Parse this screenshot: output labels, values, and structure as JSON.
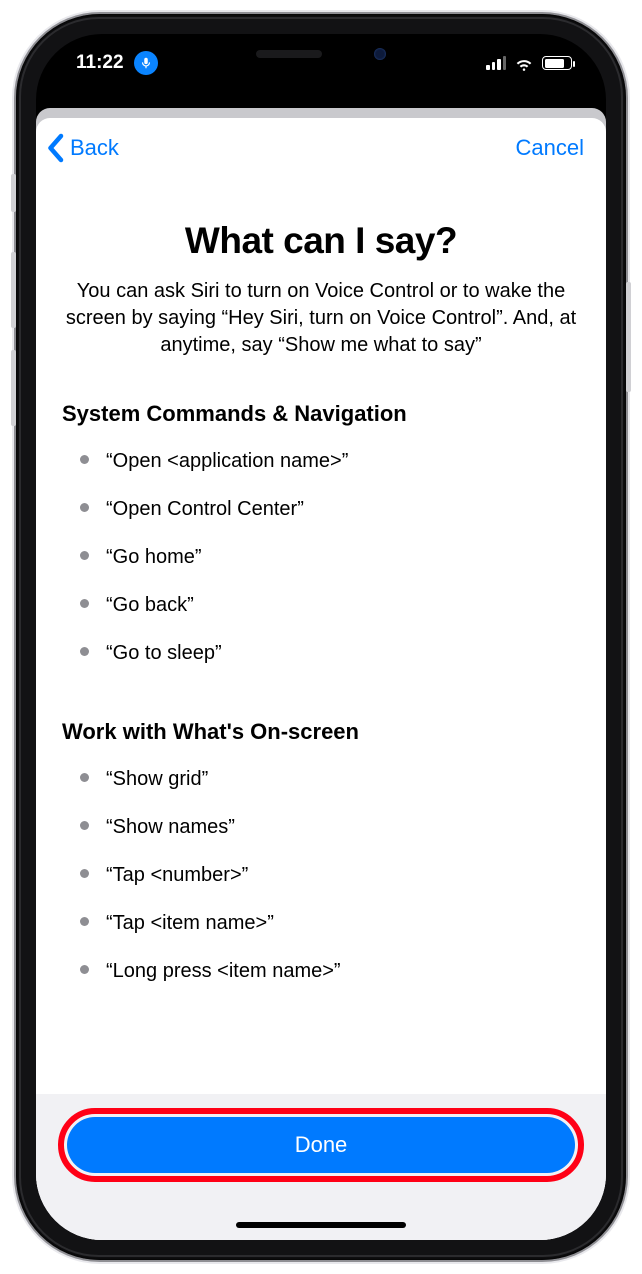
{
  "status": {
    "time": "11:22",
    "mic_active": true
  },
  "nav": {
    "back_label": "Back",
    "cancel_label": "Cancel"
  },
  "page": {
    "title": "What can I say?",
    "subtitle": "You can ask Siri to turn on Voice Control or to wake the screen by saying “Hey Siri, turn on Voice Control”. And, at anytime, say “Show me what to say”"
  },
  "sections": {
    "system": {
      "heading": "System Commands & Navigation",
      "items": [
        "“Open <application name>”",
        "“Open Control Center”",
        "“Go home”",
        "“Go back”",
        "“Go to sleep”"
      ]
    },
    "onscreen": {
      "heading": "Work with What's On-screen",
      "items": [
        "“Show grid”",
        "“Show names”",
        "“Tap <number>”",
        "“Tap <item name>”",
        "“Long press <item name>”"
      ]
    }
  },
  "footer": {
    "done_label": "Done"
  }
}
